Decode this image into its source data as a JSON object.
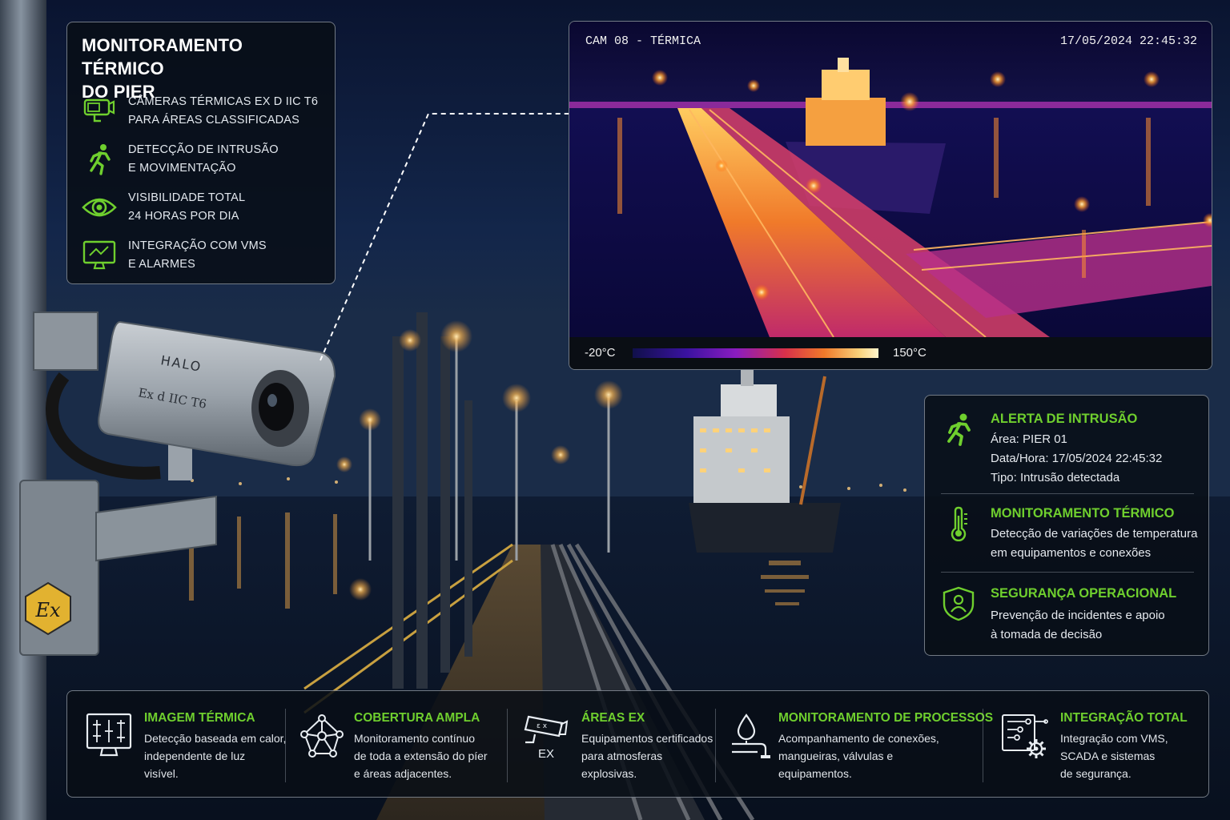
{
  "colors": {
    "accent_green": "#6fcf2e",
    "panel_bg": "#080e16",
    "night_sky": "#0b1830"
  },
  "info_panel": {
    "title_line1": "MONITORAMENTO TÉRMICO",
    "title_line2": "DO PIER",
    "features": [
      {
        "icon": "thermal-camera-icon",
        "line1": "CÂMERAS TÉRMICAS EX D IIC T6",
        "line2": "PARA ÁREAS CLASSIFICADAS"
      },
      {
        "icon": "running-person-icon",
        "line1": "DETECÇÃO DE INTRUSÃO",
        "line2": "E MOVIMENTAÇÃO"
      },
      {
        "icon": "eye-icon",
        "line1": "VISIBILIDADE TOTAL",
        "line2": "24 HORAS POR DIA"
      },
      {
        "icon": "monitor-icon",
        "line1": "INTEGRAÇÃO COM VMS",
        "line2": "E ALARMES"
      }
    ]
  },
  "camera": {
    "brand": "HALO",
    "marking": "Ex d IIC T6",
    "ex_symbol": "Ex"
  },
  "thermal": {
    "cam_label": "CAM 08 - TÉRMICA",
    "timestamp": "17/05/2024 22:45:32",
    "temp_min": "-20°C",
    "temp_max": "150°C"
  },
  "alerts": [
    {
      "icon": "running-person-icon",
      "heading": "ALERTA DE INTRUSÃO",
      "lines": [
        "Área: PIER 01",
        "Data/Hora: 17/05/2024 22:45:32",
        "Tipo: Intrusão detectada"
      ]
    },
    {
      "icon": "thermometer-icon",
      "heading": "MONITORAMENTO TÉRMICO",
      "lines": [
        "Detecção de variações de temperatura",
        "em equipamentos e conexões"
      ]
    },
    {
      "icon": "shield-person-icon",
      "heading": "SEGURANÇA OPERACIONAL",
      "lines": [
        "Prevenção de incidentes e apoio",
        "à tomada de decisão"
      ]
    }
  ],
  "bottom": [
    {
      "icon": "thermal-grid-monitor-icon",
      "heading": "IMAGEM TÉRMICA",
      "lines": [
        "Detecção baseada em calor,",
        "independente de luz",
        "visível."
      ]
    },
    {
      "icon": "network-nodes-icon",
      "heading": "COBERTURA AMPLA",
      "lines": [
        "Monitoramento contínuo",
        "de toda a extensão do píer",
        "e áreas adjacentes."
      ]
    },
    {
      "icon": "ex-camera-icon",
      "heading": "ÁREAS EX",
      "icon_label": "EX",
      "lines": [
        "Equipamentos certificados",
        "para atmosferas",
        "explosivas."
      ]
    },
    {
      "icon": "drop-pipe-icon",
      "heading": "MONITORAMENTO DE PROCESSOS",
      "lines": [
        "Acompanhamento de conexões,",
        "mangueiras, válvulas e",
        "equipamentos."
      ]
    },
    {
      "icon": "integration-gear-icon",
      "heading": "INTEGRAÇÃO TOTAL",
      "lines": [
        "Integração com VMS,",
        "SCADA e sistemas",
        "de segurança."
      ]
    }
  ]
}
